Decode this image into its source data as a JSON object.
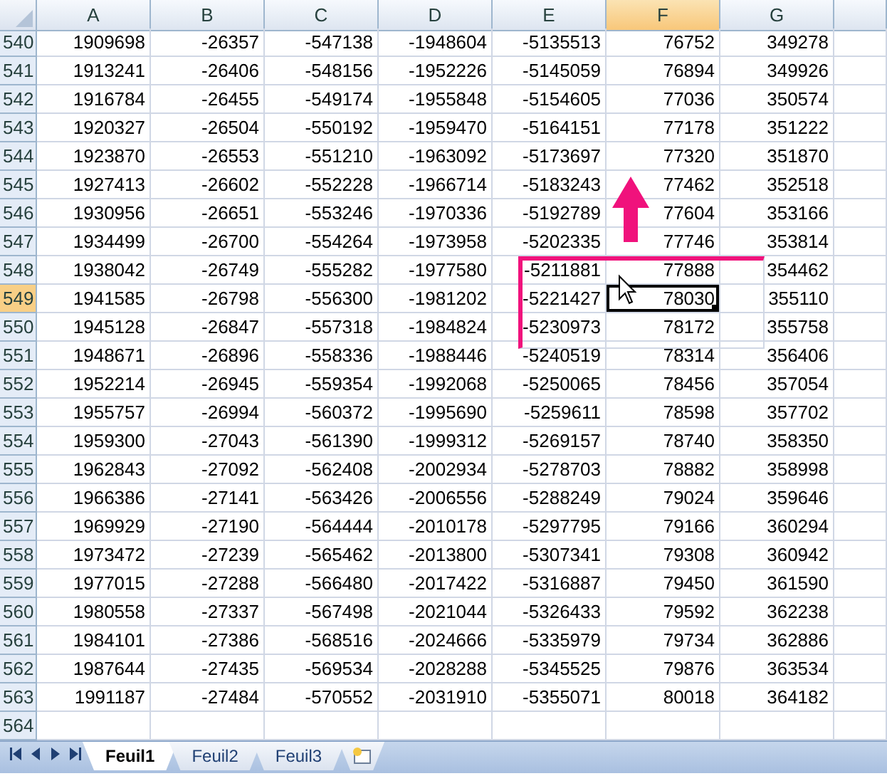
{
  "columns": [
    {
      "label": "A",
      "selected": false
    },
    {
      "label": "B",
      "selected": false
    },
    {
      "label": "C",
      "selected": false
    },
    {
      "label": "D",
      "selected": false
    },
    {
      "label": "E",
      "selected": false
    },
    {
      "label": "F",
      "selected": true
    },
    {
      "label": "G",
      "selected": false
    }
  ],
  "rows": [
    {
      "header": "540",
      "selected": false,
      "cells": [
        "1909698",
        "-26357",
        "-547138",
        "-1948604",
        "-5135513",
        "76752",
        "349278"
      ]
    },
    {
      "header": "541",
      "selected": false,
      "cells": [
        "1913241",
        "-26406",
        "-548156",
        "-1952226",
        "-5145059",
        "76894",
        "349926"
      ]
    },
    {
      "header": "542",
      "selected": false,
      "cells": [
        "1916784",
        "-26455",
        "-549174",
        "-1955848",
        "-5154605",
        "77036",
        "350574"
      ]
    },
    {
      "header": "543",
      "selected": false,
      "cells": [
        "1920327",
        "-26504",
        "-550192",
        "-1959470",
        "-5164151",
        "77178",
        "351222"
      ]
    },
    {
      "header": "544",
      "selected": false,
      "cells": [
        "1923870",
        "-26553",
        "-551210",
        "-1963092",
        "-5173697",
        "77320",
        "351870"
      ]
    },
    {
      "header": "545",
      "selected": false,
      "cells": [
        "1927413",
        "-26602",
        "-552228",
        "-1966714",
        "-5183243",
        "77462",
        "352518"
      ]
    },
    {
      "header": "546",
      "selected": false,
      "cells": [
        "1930956",
        "-26651",
        "-553246",
        "-1970336",
        "-5192789",
        "77604",
        "353166"
      ]
    },
    {
      "header": "547",
      "selected": false,
      "cells": [
        "1934499",
        "-26700",
        "-554264",
        "-1973958",
        "-5202335",
        "77746",
        "353814"
      ]
    },
    {
      "header": "548",
      "selected": false,
      "cells": [
        "1938042",
        "-26749",
        "-555282",
        "-1977580",
        "-5211881",
        "77888",
        "354462"
      ]
    },
    {
      "header": "549",
      "selected": true,
      "cells": [
        "1941585",
        "-26798",
        "-556300",
        "-1981202",
        "-5221427",
        "78030",
        "355110"
      ]
    },
    {
      "header": "550",
      "selected": false,
      "cells": [
        "1945128",
        "-26847",
        "-557318",
        "-1984824",
        "-5230973",
        "78172",
        "355758"
      ]
    },
    {
      "header": "551",
      "selected": false,
      "cells": [
        "1948671",
        "-26896",
        "-558336",
        "-1988446",
        "-5240519",
        "78314",
        "356406"
      ]
    },
    {
      "header": "552",
      "selected": false,
      "cells": [
        "1952214",
        "-26945",
        "-559354",
        "-1992068",
        "-5250065",
        "78456",
        "357054"
      ]
    },
    {
      "header": "553",
      "selected": false,
      "cells": [
        "1955757",
        "-26994",
        "-560372",
        "-1995690",
        "-5259611",
        "78598",
        "357702"
      ]
    },
    {
      "header": "554",
      "selected": false,
      "cells": [
        "1959300",
        "-27043",
        "-561390",
        "-1999312",
        "-5269157",
        "78740",
        "358350"
      ]
    },
    {
      "header": "555",
      "selected": false,
      "cells": [
        "1962843",
        "-27092",
        "-562408",
        "-2002934",
        "-5278703",
        "78882",
        "358998"
      ]
    },
    {
      "header": "556",
      "selected": false,
      "cells": [
        "1966386",
        "-27141",
        "-563426",
        "-2006556",
        "-5288249",
        "79024",
        "359646"
      ]
    },
    {
      "header": "557",
      "selected": false,
      "cells": [
        "1969929",
        "-27190",
        "-564444",
        "-2010178",
        "-5297795",
        "79166",
        "360294"
      ]
    },
    {
      "header": "558",
      "selected": false,
      "cells": [
        "1973472",
        "-27239",
        "-565462",
        "-2013800",
        "-5307341",
        "79308",
        "360942"
      ]
    },
    {
      "header": "559",
      "selected": false,
      "cells": [
        "1977015",
        "-27288",
        "-566480",
        "-2017422",
        "-5316887",
        "79450",
        "361590"
      ]
    },
    {
      "header": "560",
      "selected": false,
      "cells": [
        "1980558",
        "-27337",
        "-567498",
        "-2021044",
        "-5326433",
        "79592",
        "362238"
      ]
    },
    {
      "header": "561",
      "selected": false,
      "cells": [
        "1984101",
        "-27386",
        "-568516",
        "-2024666",
        "-5335979",
        "79734",
        "362886"
      ]
    },
    {
      "header": "562",
      "selected": false,
      "cells": [
        "1987644",
        "-27435",
        "-569534",
        "-2028288",
        "-5345525",
        "79876",
        "363534"
      ]
    },
    {
      "header": "563",
      "selected": false,
      "cells": [
        "1991187",
        "-27484",
        "-570552",
        "-2031910",
        "-5355071",
        "80018",
        "364182"
      ]
    },
    {
      "header": "564",
      "selected": false,
      "cells": []
    }
  ],
  "sheet_tabs": [
    {
      "label": "Feuil1",
      "selected": true
    },
    {
      "label": "Feuil2",
      "selected": false
    },
    {
      "label": "Feuil3",
      "selected": false
    }
  ]
}
